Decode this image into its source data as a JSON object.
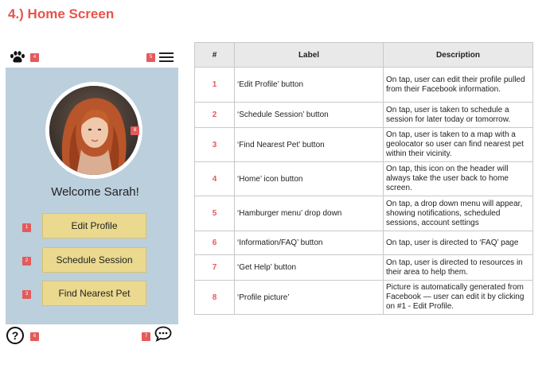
{
  "page_title": "4.) Home Screen",
  "phone": {
    "header": {
      "home_icon": "paw-icon",
      "menu_icon": "hamburger-icon",
      "badge_home": "4",
      "badge_menu": "5"
    },
    "profile": {
      "badge": "8",
      "welcome_text": "Welcome Sarah!"
    },
    "buttons": [
      {
        "badge": "1",
        "label": "Edit Profile"
      },
      {
        "badge": "2",
        "label": "Schedule Session"
      },
      {
        "badge": "3",
        "label": "Find Nearest Pet"
      }
    ],
    "footer": {
      "help_icon": "question-circle-icon",
      "help_glyph": "?",
      "chat_icon": "speech-bubble-icon",
      "badge_help": "6",
      "badge_chat": "7"
    }
  },
  "table": {
    "headers": [
      "#",
      "Label",
      "Description"
    ],
    "rows": [
      {
        "num": "1",
        "label": "‘Edit Profile’ button",
        "desc": "On tap, user can edit their profile pulled from their Facebook information."
      },
      {
        "num": "2",
        "label": "‘Schedule Session’ button",
        "desc": "On tap, user is taken to schedule a session for later today or tomorrow."
      },
      {
        "num": "3",
        "label": "‘Find Nearest Pet’ button",
        "desc": "On tap, user is taken to a map with a geolocator so user can find nearest pet within their vicinity."
      },
      {
        "num": "4",
        "label": "‘Home’ icon button",
        "desc": "On tap, this icon on the header will always take the user back to home screen."
      },
      {
        "num": "5",
        "label": "‘Hamburger menu’ drop down",
        "desc": "On tap, a drop down menu will appear, showing notifications, scheduled sessions, account settings"
      },
      {
        "num": "6",
        "label": "‘Information/FAQ’ button",
        "desc": "On tap, user is directed to ‘FAQ’ page"
      },
      {
        "num": "7",
        "label": "‘Get Help’ button",
        "desc": "On tap, user is directed to resources in their area to help them."
      },
      {
        "num": "8",
        "label": "‘Profile picture’",
        "desc": "Picture is automatically generated from Facebook — user can edit it by clicking on #1 - Edit Profile."
      }
    ]
  },
  "colors": {
    "title": "#e8534a",
    "badge": "#e35b5b",
    "phone_bg": "#bccfdd",
    "button_bg": "#ead98e"
  }
}
